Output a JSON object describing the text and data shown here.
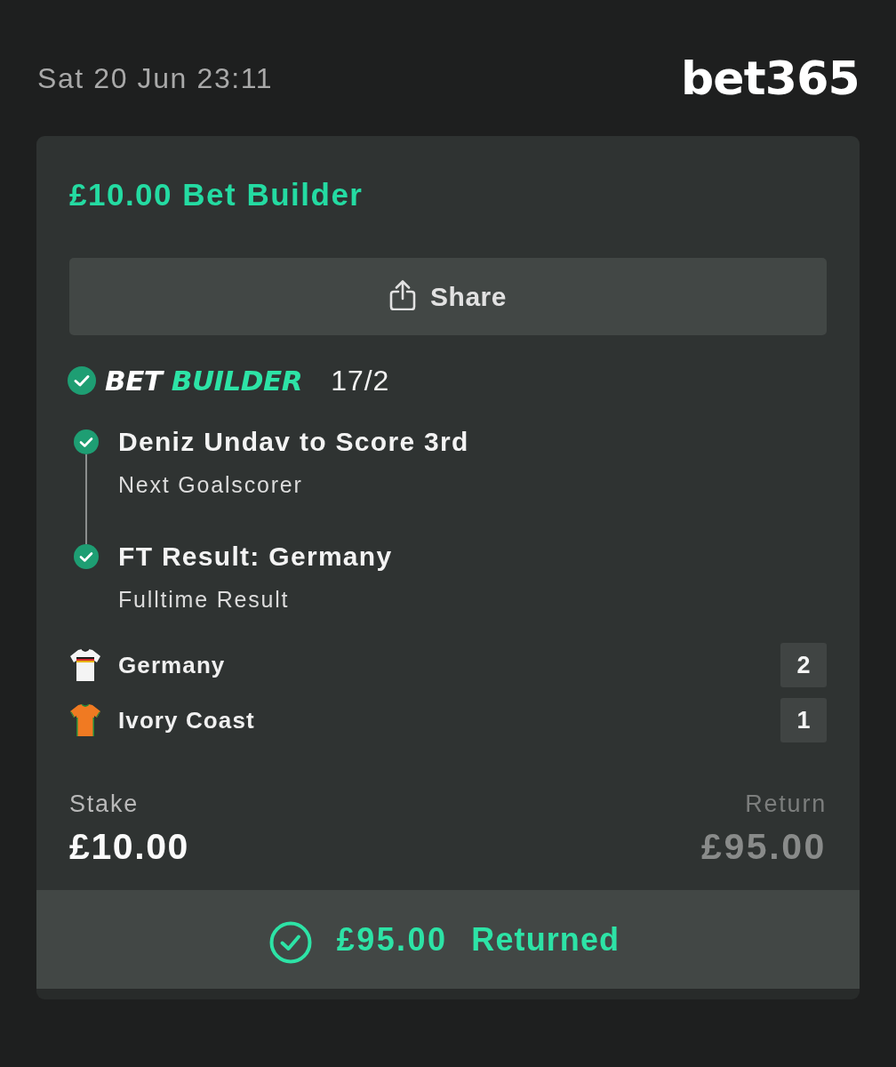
{
  "status": {
    "datetime": "Sat 20 Jun 23:11"
  },
  "logo": {
    "text": "bet365"
  },
  "bet": {
    "title": "£10.00 Bet Builder",
    "share_button": {
      "label": "Share"
    },
    "bet_type": {
      "prefix": "BET",
      "name": "BUILDER",
      "won": true
    },
    "odds": "17/2",
    "legs": [
      {
        "selection": "Deniz Undav to Score 3rd",
        "market": "Next Goalscorer",
        "won": true
      },
      {
        "selection": "FT Result: Germany",
        "market": "Fulltime Result",
        "won": true
      }
    ],
    "teams": [
      {
        "name": "Germany",
        "score": "2",
        "color": "#f4f4f4",
        "kind": "chest-band"
      },
      {
        "name": "Ivory Coast",
        "score": "1",
        "color": "#f07a22",
        "kind": "sleeve-stripes"
      }
    ],
    "stake": {
      "label": "Stake",
      "amount": "£10.00"
    },
    "return": {
      "label": "Return",
      "amount": "£95.00"
    },
    "result": {
      "amount": "£95.00",
      "status": "Returned",
      "settled": true
    }
  }
}
